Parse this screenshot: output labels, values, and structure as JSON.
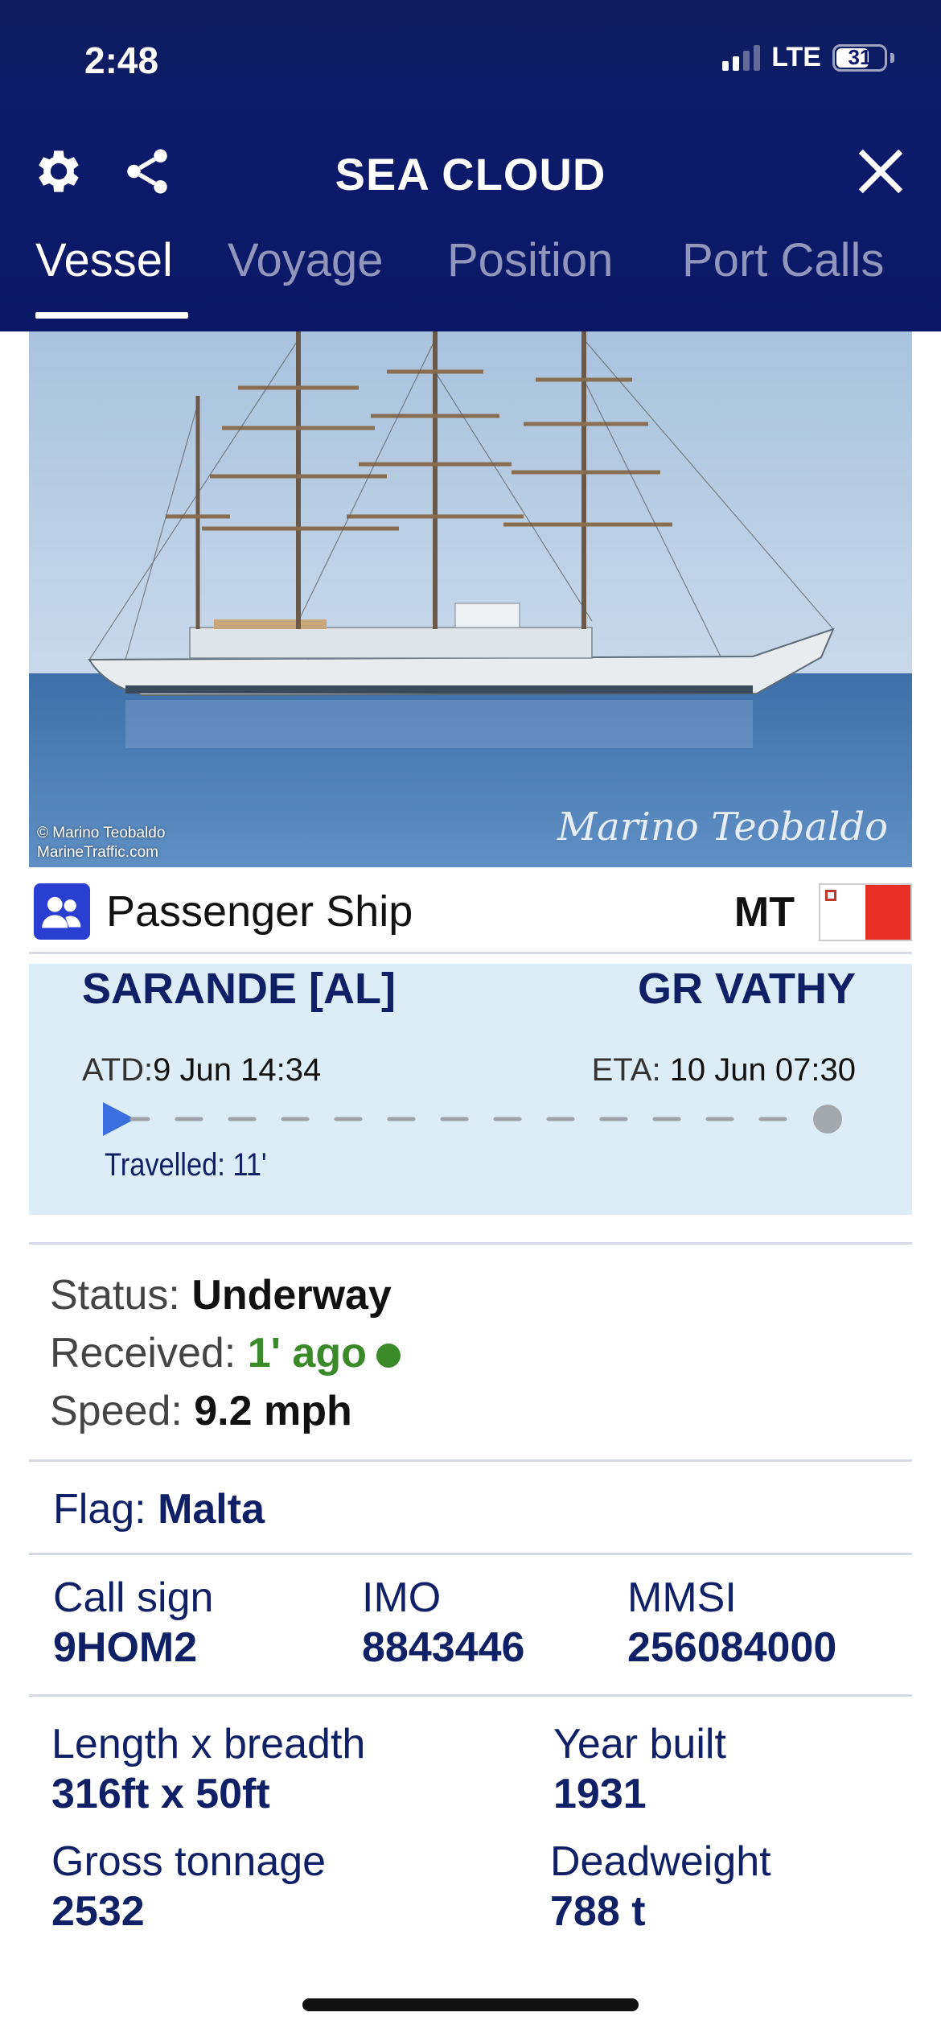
{
  "status_bar": {
    "time": "2:48",
    "network": "LTE",
    "battery": "31"
  },
  "header": {
    "title": "SEA CLOUD",
    "tabs": [
      {
        "label": "Vessel",
        "active": true
      },
      {
        "label": "Voyage",
        "active": false
      },
      {
        "label": "Position",
        "active": false
      },
      {
        "label": "Port Calls",
        "active": false
      }
    ],
    "icons": {
      "settings": "gear-icon",
      "share": "share-icon",
      "close": "close-icon"
    }
  },
  "photo": {
    "credit_line1": "© Marino Teobaldo",
    "credit_line2": "MarineTraffic.com",
    "signature": "Marino Teobaldo"
  },
  "vessel_type": {
    "label": "Passenger Ship",
    "flag_code": "MT",
    "icon": "passenger-icon"
  },
  "route": {
    "from": "SARANDE [AL]",
    "to": "GR VATHY",
    "atd_label": "ATD:",
    "atd_value": "9 Jun 14:34",
    "eta_label": "ETA:",
    "eta_value": "10 Jun 07:30",
    "travelled": "Travelled: 11'"
  },
  "status": {
    "status_label": "Status:",
    "status_value": "Underway",
    "received_label": "Received:",
    "received_value": "1' ago",
    "speed_label": "Speed:",
    "speed_value": "9.2 mph"
  },
  "flag": {
    "label": "Flag:",
    "value": "Malta"
  },
  "ids": {
    "callsign_label": "Call sign",
    "callsign_value": "9HOM2",
    "imo_label": "IMO",
    "imo_value": "8843446",
    "mmsi_label": "MMSI",
    "mmsi_value": "256084000"
  },
  "dimensions": {
    "length_label": "Length x breadth",
    "length_value": "316ft x 50ft",
    "year_label": "Year built",
    "year_value": "1931",
    "gross_label": "Gross tonnage",
    "gross_value": "2532",
    "deadweight_label": "Deadweight",
    "deadweight_value": "788 t"
  },
  "colors": {
    "header_bg": "#0d1a6b",
    "route_bg": "#dcedf8",
    "accent_text": "#102066",
    "received_green": "#3a8a2a",
    "progress_arrow": "#3b6fe0"
  }
}
